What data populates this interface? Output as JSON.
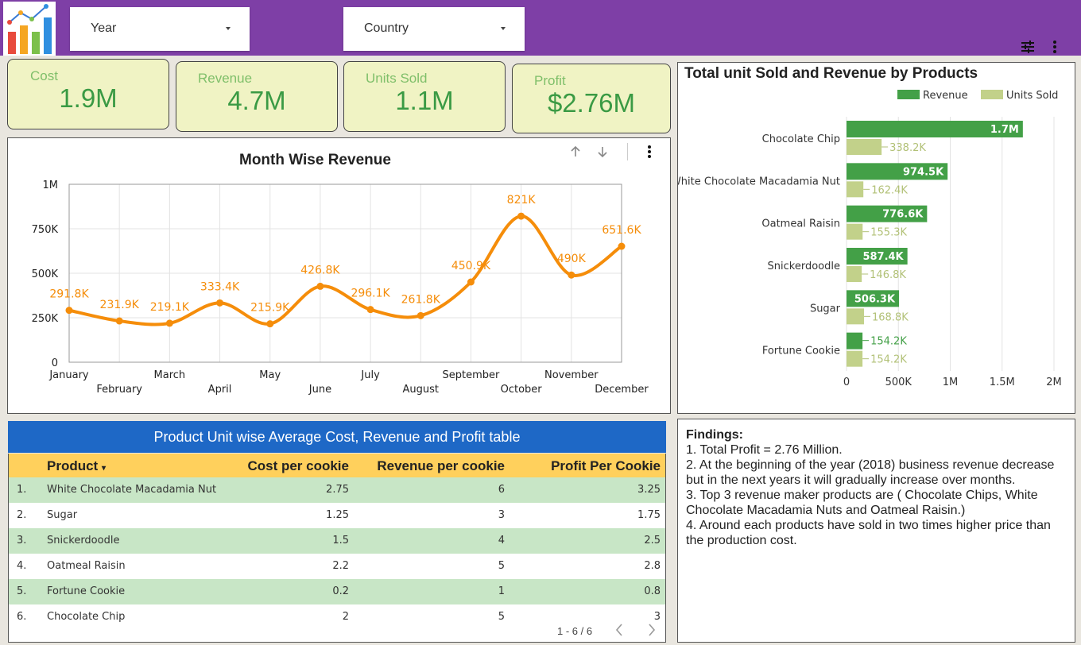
{
  "header": {
    "filters": [
      {
        "label": "Year"
      },
      {
        "label": "Country"
      }
    ],
    "icons": [
      "chart-logo-icon",
      "filter-settings-icon",
      "more-vert-icon"
    ]
  },
  "kpis": {
    "cost": {
      "label": "Cost",
      "value": "1.9M"
    },
    "revenue": {
      "label": "Revenue",
      "value": "4.7M"
    },
    "units": {
      "label": "Units Sold",
      "value": "1.1M"
    },
    "profit": {
      "label": "Profit",
      "value": "$2.76M"
    }
  },
  "month_chart": {
    "title": "Month Wise Revenue",
    "colors": {
      "line": "#f58d0a",
      "grid": "#e3e3e3"
    },
    "chart_data": {
      "type": "line",
      "title": "Month Wise Revenue",
      "x": [
        "January",
        "February",
        "March",
        "April",
        "May",
        "June",
        "July",
        "August",
        "September",
        "October",
        "November",
        "December"
      ],
      "values": [
        291800,
        231900,
        219100,
        333400,
        215900,
        426800,
        296100,
        261800,
        450900,
        821000,
        490000,
        651600
      ],
      "data_labels": [
        "291.8K",
        "231.9K",
        "219.1K",
        "333.4K",
        "215.9K",
        "426.8K",
        "296.1K",
        "261.8K",
        "450.9K",
        "821K",
        "490K",
        "651.6K"
      ],
      "ylim": [
        0,
        1000000
      ],
      "yticks": [
        0,
        250000,
        500000,
        750000,
        1000000
      ],
      "ytick_labels": [
        "0",
        "250K",
        "500K",
        "750K",
        "1M"
      ],
      "grid": true
    }
  },
  "product_chart": {
    "title": "Total unit Sold and Revenue by Products",
    "colors": {
      "revenue": "#43a047",
      "units": "#c2d18a",
      "units_text": "#b2c177"
    },
    "chart_data": {
      "type": "bar",
      "orientation": "horizontal",
      "title": "Total unit Sold and Revenue by Products",
      "categories": [
        "Chocolate Chip",
        "White Chocolate Macadamia Nut",
        "Oatmeal Raisin",
        "Snickerdoodle",
        "Sugar",
        "Fortune Cookie"
      ],
      "series": [
        {
          "name": "Revenue",
          "values": [
            1700000,
            974500,
            776600,
            587400,
            506300,
            154200
          ],
          "labels": [
            "1.7M",
            "974.5K",
            "776.6K",
            "587.4K",
            "506.3K",
            "154.2K"
          ]
        },
        {
          "name": "Units Sold",
          "values": [
            338200,
            162400,
            155300,
            146800,
            168800,
            154200
          ],
          "labels": [
            "338.2K",
            "162.4K",
            "155.3K",
            "146.8K",
            "168.8K",
            "154.2K"
          ]
        }
      ],
      "xlim": [
        0,
        2000000
      ],
      "xticks": [
        0,
        500000,
        1000000,
        1500000,
        2000000
      ],
      "xtick_labels": [
        "0",
        "500K",
        "1M",
        "1.5M",
        "2M"
      ],
      "legend": "top-right",
      "grid": true
    }
  },
  "table": {
    "title": "Product Unit wise Average Cost, Revenue and Profit table",
    "headers": {
      "product": "Product",
      "cost": "Cost per cookie",
      "revenue": "Revenue per cookie",
      "profit": "Profit Per Cookie"
    },
    "rows": [
      {
        "idx": "1.",
        "product": "White Chocolate Macadamia Nut",
        "cost": "2.75",
        "revenue": "6",
        "profit": "3.25"
      },
      {
        "idx": "2.",
        "product": "Sugar",
        "cost": "1.25",
        "revenue": "3",
        "profit": "1.75"
      },
      {
        "idx": "3.",
        "product": "Snickerdoodle",
        "cost": "1.5",
        "revenue": "4",
        "profit": "2.5"
      },
      {
        "idx": "4.",
        "product": "Oatmeal Raisin",
        "cost": "2.2",
        "revenue": "5",
        "profit": "2.8"
      },
      {
        "idx": "5.",
        "product": "Fortune Cookie",
        "cost": "0.2",
        "revenue": "1",
        "profit": "0.8"
      },
      {
        "idx": "6.",
        "product": "Chocolate Chip",
        "cost": "2",
        "revenue": "5",
        "profit": "3"
      }
    ],
    "pagination": "1 - 6 / 6"
  },
  "findings": {
    "heading": "Findings:",
    "lines": [
      "1. Total Profit = 2.76 Million.",
      "2. At the beginning of the year (2018) business revenue decrease but in the next years it will gradually increase over months.",
      "3. Top 3  revenue maker products are ( Chocolate Chips, White Chocolate Macadamia Nuts and Oatmeal Raisin.)",
      "4. Around each products have sold in two times higher price than the production cost."
    ]
  }
}
